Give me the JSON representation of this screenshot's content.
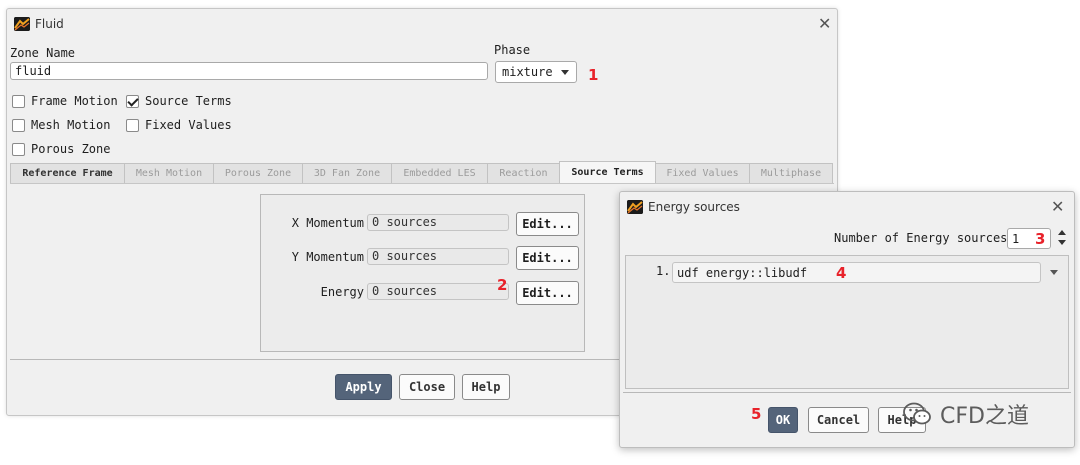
{
  "fluid_dialog": {
    "title": "Fluid",
    "zone_name_label": "Zone Name",
    "zone_name_value": "fluid",
    "phase_label": "Phase",
    "phase_value": "mixture",
    "checkboxes": [
      {
        "label": "Frame Motion",
        "checked": false
      },
      {
        "label": "Source Terms",
        "checked": true
      },
      {
        "label": "Mesh Motion",
        "checked": false
      },
      {
        "label": "Fixed Values",
        "checked": false
      },
      {
        "label": "Porous Zone",
        "checked": false
      }
    ],
    "tabs": [
      {
        "label": "Reference Frame"
      },
      {
        "label": "Mesh Motion"
      },
      {
        "label": "Porous Zone"
      },
      {
        "label": "3D Fan Zone"
      },
      {
        "label": "Embedded LES"
      },
      {
        "label": "Reaction"
      },
      {
        "label": "Source Terms"
      },
      {
        "label": "Fixed Values"
      },
      {
        "label": "Multiphase"
      }
    ],
    "active_tab": "Source Terms",
    "source_rows": [
      {
        "label": "X Momentum",
        "value": "0 sources",
        "button": "Edit..."
      },
      {
        "label": "Y Momentum",
        "value": "0 sources",
        "button": "Edit..."
      },
      {
        "label": "Energy",
        "value": "0 sources",
        "button": "Edit..."
      }
    ],
    "buttons": {
      "apply": "Apply",
      "close": "Close",
      "help": "Help"
    }
  },
  "energy_dialog": {
    "title": "Energy sources",
    "count_label": "Number of Energy sources",
    "count_value": "1",
    "entries": [
      {
        "index": "1.",
        "value": "udf energy::libudf"
      }
    ],
    "buttons": {
      "ok": "OK",
      "cancel": "Cancel",
      "help": "Help"
    }
  },
  "markers": [
    "1",
    "2",
    "3",
    "4",
    "5"
  ],
  "watermark": {
    "text": "CFD之道"
  },
  "colors": {
    "primary_button": "#54647a",
    "marker": "#e8222a",
    "dialog_bg": "#f0f0f0"
  }
}
